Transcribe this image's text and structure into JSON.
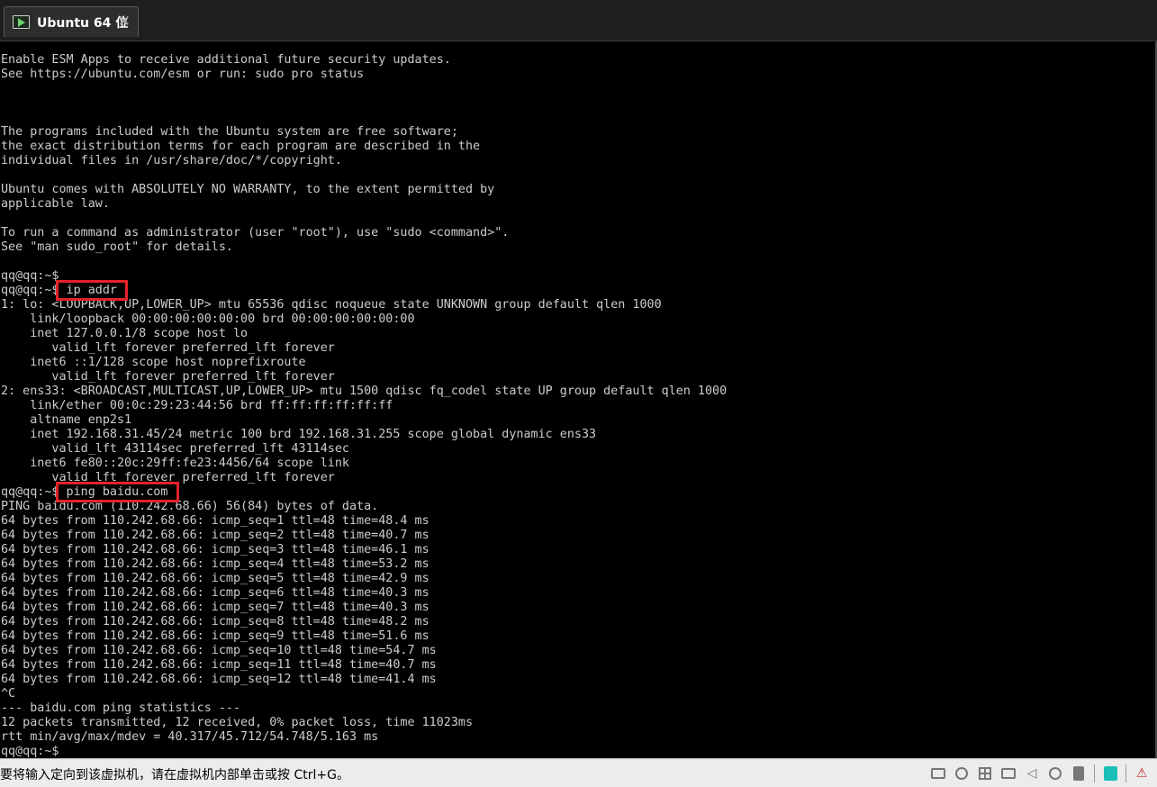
{
  "tab": {
    "title": "Ubuntu 64 位",
    "close_glyph": "✕",
    "icon": "vm-play-icon"
  },
  "terminal": {
    "lines": [
      "Enable ESM Apps to receive additional future security updates.",
      "See https://ubuntu.com/esm or run: sudo pro status",
      "",
      "",
      "",
      "The programs included with the Ubuntu system are free software;",
      "the exact distribution terms for each program are described in the",
      "individual files in /usr/share/doc/*/copyright.",
      "",
      "Ubuntu comes with ABSOLUTELY NO WARRANTY, to the extent permitted by",
      "applicable law.",
      "",
      "To run a command as administrator (user \"root\"), use \"sudo <command>\".",
      "See \"man sudo_root\" for details.",
      "",
      "qq@qq:~$",
      "qq@qq:~$ ip addr",
      "1: lo: <LOOPBACK,UP,LOWER_UP> mtu 65536 qdisc noqueue state UNKNOWN group default qlen 1000",
      "    link/loopback 00:00:00:00:00:00 brd 00:00:00:00:00:00",
      "    inet 127.0.0.1/8 scope host lo",
      "       valid_lft forever preferred_lft forever",
      "    inet6 ::1/128 scope host noprefixroute",
      "       valid_lft forever preferred_lft forever",
      "2: ens33: <BROADCAST,MULTICAST,UP,LOWER_UP> mtu 1500 qdisc fq_codel state UP group default qlen 1000",
      "    link/ether 00:0c:29:23:44:56 brd ff:ff:ff:ff:ff:ff",
      "    altname enp2s1",
      "    inet 192.168.31.45/24 metric 100 brd 192.168.31.255 scope global dynamic ens33",
      "       valid_lft 43114sec preferred_lft 43114sec",
      "    inet6 fe80::20c:29ff:fe23:4456/64 scope link",
      "       valid_lft forever preferred_lft forever",
      "qq@qq:~$ ping baidu.com",
      "PING baidu.com (110.242.68.66) 56(84) bytes of data.",
      "64 bytes from 110.242.68.66: icmp_seq=1 ttl=48 time=48.4 ms",
      "64 bytes from 110.242.68.66: icmp_seq=2 ttl=48 time=40.7 ms",
      "64 bytes from 110.242.68.66: icmp_seq=3 ttl=48 time=46.1 ms",
      "64 bytes from 110.242.68.66: icmp_seq=4 ttl=48 time=53.2 ms",
      "64 bytes from 110.242.68.66: icmp_seq=5 ttl=48 time=42.9 ms",
      "64 bytes from 110.242.68.66: icmp_seq=6 ttl=48 time=40.3 ms",
      "64 bytes from 110.242.68.66: icmp_seq=7 ttl=48 time=40.3 ms",
      "64 bytes from 110.242.68.66: icmp_seq=8 ttl=48 time=48.2 ms",
      "64 bytes from 110.242.68.66: icmp_seq=9 ttl=48 time=51.6 ms",
      "64 bytes from 110.242.68.66: icmp_seq=10 ttl=48 time=54.7 ms",
      "64 bytes from 110.242.68.66: icmp_seq=11 ttl=48 time=40.7 ms",
      "64 bytes from 110.242.68.66: icmp_seq=12 ttl=48 time=41.4 ms",
      "^C",
      "--- baidu.com ping statistics ---",
      "12 packets transmitted, 12 received, 0% packet loss, time 11023ms",
      "rtt min/avg/max/mdev = 40.317/45.712/54.748/5.163 ms",
      "qq@qq:~$"
    ],
    "highlights": [
      {
        "line": 16,
        "prompt": "qq@qq:~$ ",
        "command": "ip addr"
      },
      {
        "line": 30,
        "prompt": "qq@qq:~$ ",
        "command": "ping baidu.com"
      }
    ],
    "highlight_color": "#e3222a",
    "text_color": "#cccccc",
    "background": "#000000"
  },
  "statusbar": {
    "message": "要将输入定向到该虚拟机，请在虚拟机内部单击或按 Ctrl+G。",
    "icons": [
      "network-adapter-icon",
      "cd-dvd-icon",
      "network-icon",
      "printer-icon",
      "sound-icon",
      "usb-icon",
      "hard-disk-icon",
      "display-icon",
      "disconnect-icon"
    ]
  }
}
